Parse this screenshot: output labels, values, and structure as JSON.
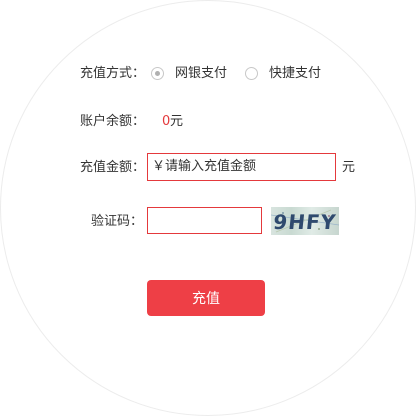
{
  "form": {
    "method_label": "充值方式：",
    "method_options": [
      {
        "label": "网银支付",
        "checked": true
      },
      {
        "label": "快捷支付",
        "checked": false
      }
    ],
    "balance_label": "账户余额：",
    "balance_value": "0",
    "balance_unit": "元",
    "amount_label": "充值金额：",
    "amount_value": "￥请输入充值金额",
    "amount_unit": "元",
    "captcha_label": "验证码：",
    "captcha_value": "",
    "captcha_text": "9HFY",
    "submit_label": "充值"
  },
  "colors": {
    "accent": "#ee3f46",
    "balance_value": "#e4393c",
    "input_border": "#e4393c"
  }
}
